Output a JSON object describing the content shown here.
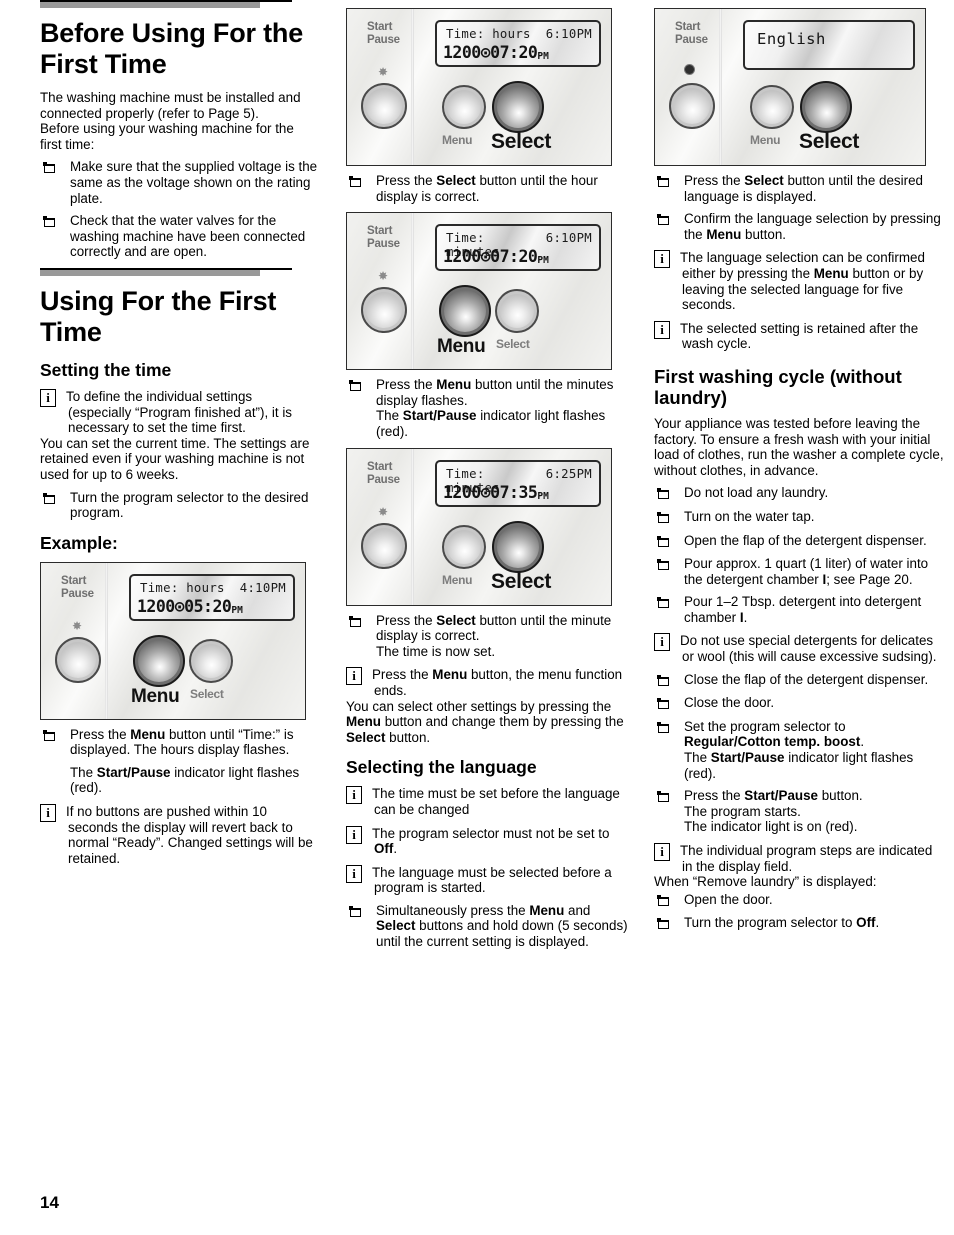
{
  "page": {
    "number": "14"
  },
  "column1": {
    "heading1": "Before Using For the First Time",
    "intro1": "The washing machine must be installed and connected properly (refer to Page 5).",
    "intro2": "Before using your washing machine for the first time:",
    "bullet1": "Make sure that the supplied voltage is the same as the voltage shown on the rating plate.",
    "bullet2": "Check that the water valves for the washing machine have been connected correctly and are open.",
    "heading2": "Using For the First Time",
    "subheading1": "Setting the time",
    "info1": "To define the individual settings (especially “Program finished at”), it is necessary to set the time first.",
    "para1": "You can set the current time. The settings are retained even if your washing machine is not used for up  to 6 weeks.",
    "bullet3": "Turn the program selector to the desired program.",
    "subheading2": "Example:",
    "panel": {
      "start_pause_label": "Start\nPause",
      "indicator": "starburst",
      "lcd_line1_left": "Time: hours",
      "lcd_line1_right": "4:10PM",
      "lcd_line2": "1200⊙05:20",
      "lcd_line2_suffix": "PM",
      "menu_label": "Menu",
      "select_label": "Select",
      "highlighted_button": "Menu"
    },
    "bullet4_a": "Press the ",
    "bullet4_b": "Menu",
    "bullet4_c": " button until “Time:” is displayed. The hours display flashes.",
    "bullet4_line2_a": "The ",
    "bullet4_line2_b": "Start/Pause",
    "bullet4_line2_c": " indicator light flashes (red).",
    "info2": "If no buttons are pushed within 10 seconds the display will revert back to normal “Ready”. Changed settings will be retained."
  },
  "column2": {
    "panel1": {
      "start_pause_label": "Start\nPause",
      "indicator": "starburst",
      "lcd_line1_left": "Time: hours",
      "lcd_line1_right": "6:10PM",
      "lcd_line2": "1200⊙07:20",
      "lcd_line2_suffix": "PM",
      "menu_label": "Menu",
      "select_label": "Select",
      "highlighted_button": "Select"
    },
    "bullet1_a": "Press the ",
    "bullet1_b": "Select",
    "bullet1_c": " button until the hour display is correct.",
    "panel2": {
      "start_pause_label": "Start\nPause",
      "indicator": "starburst",
      "lcd_line1_left": "Time: minutes",
      "lcd_line1_right": "6:10PM",
      "lcd_line2": "1200⊙07:20",
      "lcd_line2_suffix": "PM",
      "menu_label": "Menu",
      "select_label": "Select",
      "highlighted_button": "Menu"
    },
    "bullet2_a": "Press the ",
    "bullet2_b": "Menu",
    "bullet2_c": " button until the minutes display flashes.",
    "bullet2_d": "The ",
    "bullet2_e": "Start/Pause",
    "bullet2_f": " indicator light flashes (red).",
    "panel3": {
      "start_pause_label": "Start\nPause",
      "indicator": "starburst",
      "lcd_line1_left": "Time: minutes",
      "lcd_line1_right": "6:25PM",
      "lcd_line2": "1200⊙07:35",
      "lcd_line2_suffix": "PM",
      "menu_label": "Menu",
      "select_label": "Select",
      "highlighted_button": "Select"
    },
    "bullet3_a": "Press the ",
    "bullet3_b": "Select",
    "bullet3_c": " button until the minute display is correct.",
    "bullet3_d": "The time is now set.",
    "info1_a": "Press the ",
    "info1_b": "Menu",
    "info1_c": " button, the menu function ends.",
    "para1_a": "You can select other settings by pressing the ",
    "para1_b": "Menu",
    "para1_c": " button and change them by pressing the ",
    "para1_d": "Select",
    "para1_e": " button.",
    "subheading1": "Selecting the language",
    "info2": "The time must be set before the language can be changed",
    "info3_a": "The program selector must not be set to ",
    "info3_b": "Off",
    "info3_c": ".",
    "info4": "The language must be selected before a program is started.",
    "bullet4_a": "Simultaneously press the ",
    "bullet4_b": "Menu",
    "bullet4_c": " and ",
    "bullet4_d": "Select",
    "bullet4_e": " buttons and hold down (5 seconds) until the current setting is displayed."
  },
  "column3": {
    "panel1": {
      "start_pause_label": "Start\nPause",
      "indicator": "led-dot",
      "lcd_text": "English",
      "menu_label": "Menu",
      "select_label": "Select",
      "highlighted_button": "Select"
    },
    "bullet1_a": "Press the ",
    "bullet1_b": "Select",
    "bullet1_c": " button until the desired language is displayed.",
    "bullet2_a": "Confirm the language selection by pressing the ",
    "bullet2_b": "Menu",
    "bullet2_c": " button.",
    "info1_a": "The language selection can be confirmed either by pressing the ",
    "info1_b": "Menu",
    "info1_c": " button or by leaving the selected language for five seconds.",
    "info2": "The selected setting is retained after the wash cycle.",
    "heading1": "First washing cycle (without laundry)",
    "para1": "Your appliance was tested before leaving the factory.  To ensure a fresh wash with your initial load of clothes, run the washer a complete cycle, without clothes, in advance.",
    "bullet3": "Do not load any laundry.",
    "bullet4": "Turn on the water tap.",
    "bullet5": "Open the flap of the detergent dispenser.",
    "bullet6_a": "Pour approx. 1 quart (1 liter) of water into the detergent chamber ",
    "bullet6_b": "I",
    "bullet6_c": "; see Page 20.",
    "bullet7_a": "Pour 1–2 Tbsp. detergent into detergent chamber ",
    "bullet7_b": "I",
    "bullet7_c": ".",
    "info3": "Do not use special detergents for delicates or wool (this will cause excessive sudsing).",
    "bullet8": "Close the flap of the detergent dispenser.",
    "bullet9": "Close the door.",
    "bullet10_a": "Set the program selector to ",
    "bullet10_b": "Regular/Cotton temp. boost",
    "bullet10_c": ".",
    "bullet10_d": "The ",
    "bullet10_e": "Start/Pause",
    "bullet10_f": " indicator light flashes (red).",
    "bullet11_a": "Press the ",
    "bullet11_b": "Start/Pause",
    "bullet11_c": " button.",
    "bullet11_d": "The program starts.",
    "bullet11_e": "The indicator light is on (red).",
    "info4": "The individual program steps are indicated in the display field.",
    "para2": "When “Remove laundry” is displayed:",
    "bullet12": "Open the door.",
    "bullet13_a": "Turn the program selector to ",
    "bullet13_b": "Off",
    "bullet13_c": "."
  }
}
